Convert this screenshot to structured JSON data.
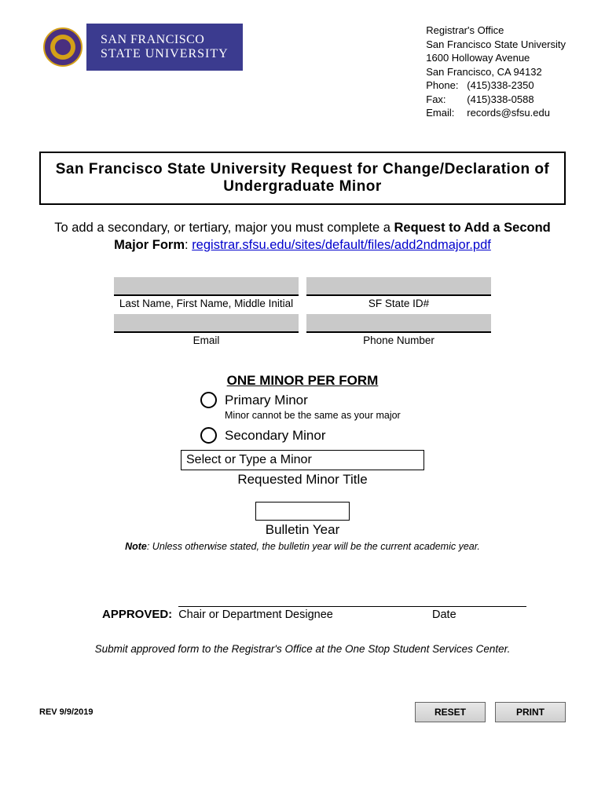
{
  "logo": {
    "line1": "SAN FRANCISCO",
    "line2": "STATE UNIVERSITY"
  },
  "address": {
    "office": "Registrar's Office",
    "univ": "San Francisco State University",
    "street": "1600 Holloway Avenue",
    "citystate": "San Francisco, CA 94132",
    "phone_lbl": "Phone:",
    "phone": "(415)338-2350",
    "fax_lbl": "Fax:",
    "fax": "(415)338-0588",
    "email_lbl": "Email:",
    "email": "records@sfsu.edu"
  },
  "title": "San Francisco State University Request for Change/Declaration of Undergraduate Minor",
  "intro": {
    "pre": "To add a secondary, or tertiary, major you must complete a ",
    "bold": "Request to Add a Second Major Form",
    "sep": ": ",
    "link": "registrar.sfsu.edu/sites/default/files/add2ndmajor.pdf"
  },
  "fields": {
    "name_label": "Last Name, First Name, Middle Initial",
    "id_label": "SF State ID#",
    "email_label": "Email",
    "phone_label": "Phone Number"
  },
  "section_heading": "ONE MINOR PER FORM",
  "radios": {
    "primary": "Primary Minor",
    "primary_note": "Minor cannot be the same as your major",
    "secondary": "Secondary Minor"
  },
  "minor_select": {
    "placeholder": "Select or Type a Minor",
    "under": "Requested Minor Title"
  },
  "bulletin": {
    "under": "Bulletin Year"
  },
  "note": {
    "bold": "Note",
    "text": ": Unless otherwise stated, the bulletin year will be the current academic year."
  },
  "approved": {
    "label": "APPROVED:",
    "chair": "Chair or Department Designee",
    "date": "Date"
  },
  "submit_note": "Submit approved form to the Registrar's Office at the One Stop Student Services Center.",
  "rev": "REV 9/9/2019",
  "buttons": {
    "reset": "RESET",
    "print": "PRINT"
  }
}
